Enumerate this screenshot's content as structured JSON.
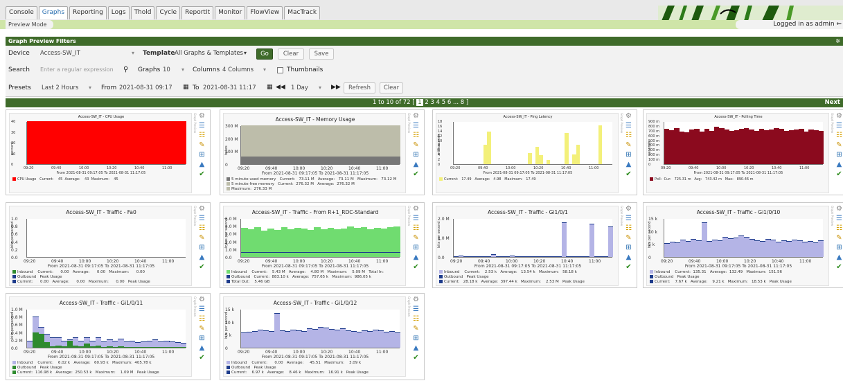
{
  "nav": {
    "tabs": [
      "Console",
      "Graphs",
      "Reporting",
      "Logs",
      "Thold",
      "Cycle",
      "ReportIt",
      "Monitor",
      "FlowView",
      "MacTrack"
    ],
    "active_tab": "Graphs",
    "breadcrumb": "Preview Mode",
    "login": "Logged in as admin"
  },
  "filters": {
    "header": "Graph Preview Filters",
    "device_label": "Device",
    "device_value": "Access-SW_IT",
    "template_label": "Template",
    "template_value": "All Graphs & Templates",
    "go": "Go",
    "clear": "Clear",
    "save": "Save",
    "search_label": "Search",
    "search_placeholder": "Enter a regular expression",
    "graphs_label": "Graphs",
    "graphs_value": "10",
    "columns_label": "Columns",
    "columns_value": "4 Columns",
    "thumbnails_label": "Thumbnails",
    "presets_label": "Presets",
    "presets_value": "Last 2 Hours",
    "from_label": "From",
    "from_value": "2021-08-31 09:17",
    "to_label": "To",
    "to_value": "2021-08-31 11:17",
    "span_value": "1 Day",
    "refresh": "Refresh",
    "clear2": "Clear"
  },
  "pagination": {
    "summary": "1 to 10 of 72 [",
    "current": "1",
    "pages": "2 3 4 5 6 ... 8 ]",
    "next": "Next"
  },
  "graphs": [
    {
      "title": "Access-SW_IT - CPU Usage",
      "ylabel": "percent",
      "yticks": [
        "40",
        "30",
        "20",
        "10",
        "0"
      ],
      "xticks": [
        "09:20",
        "09:40",
        "10:00",
        "10:20",
        "10:40",
        "11:00"
      ],
      "from": "From 2021-08-31 09:17:05 To 2021-08-31 11:17:05",
      "legend": [
        "CPU Usage   Current:    45  Average:    43  Maximum:    45"
      ],
      "colors": [
        "#ff0000"
      ],
      "values": [
        100,
        100,
        100,
        100,
        100,
        100,
        100,
        100,
        100,
        100,
        100,
        100,
        100,
        100,
        100,
        100,
        100,
        100,
        100,
        100,
        100,
        100,
        100,
        100
      ]
    },
    {
      "title": "Access-SW_IT - Memory Usage",
      "ylabel": "bytes",
      "yticks": [
        "300 M",
        "200 M",
        "100 M",
        "0"
      ],
      "xticks": [
        "09:20",
        "09:40",
        "10:00",
        "10:20",
        "10:40",
        "11:00"
      ],
      "from": "From 2021-08-31 09:17:05 To 2021-08-31 11:17:05",
      "legend": [
        "5 minute used memory   Current:   73.11 M   Average:   73.11 M   Maximum:   73.12 M",
        "5 minute free memory   Current:  276.32 M   Average:  276.32 M",
        "Maximum:  276.33 M"
      ],
      "colors": [
        "#777777",
        "#bdbdaa"
      ],
      "values": [
        100,
        100,
        100,
        100,
        100,
        100,
        100,
        100,
        100,
        100,
        100,
        100,
        100,
        100,
        100,
        100,
        100,
        100,
        100,
        100,
        100,
        100,
        100,
        100
      ]
    },
    {
      "title": "Access-SW_IT - Ping Latency",
      "ylabel": "milliseconds",
      "yticks": [
        "18",
        "16",
        "14",
        "12",
        "10",
        "8",
        "6",
        "4",
        "2",
        "0"
      ],
      "xticks": [
        "09:20",
        "09:40",
        "10:00",
        "10:20",
        "10:40",
        "11:00"
      ],
      "from": "From 2021-08-31 09:17:05 To 2021-08-31 11:17:05",
      "legend": [
        "Current:   17.49   Average:   4.98   Maximum:   17.49"
      ],
      "colors": [
        "#f3f07a"
      ],
      "values": [
        0,
        0,
        0,
        0,
        0,
        0,
        0,
        0,
        50,
        84,
        0,
        0,
        0,
        0,
        0,
        0,
        0,
        0,
        0,
        0,
        28,
        0,
        44,
        24,
        0,
        10,
        0,
        0,
        0,
        0,
        80,
        0,
        26,
        50,
        0,
        0,
        0,
        0,
        0,
        100,
        0,
        0,
        0
      ]
    },
    {
      "title": "Access-SW_IT - Polling Time",
      "ylabel": "seconds",
      "yticks": [
        "900 m",
        "800 m",
        "700 m",
        "600 m",
        "500 m",
        "400 m",
        "300 m",
        "200 m",
        "100 m",
        "0"
      ],
      "xticks": [
        "09:20",
        "09:40",
        "10:00",
        "10:20",
        "10:40",
        "11:00"
      ],
      "from": "From 2021-08-31 09:17:05 To 2021-08-31 11:17:05",
      "legend": [
        "Poll:  Cur:   725.31 m   Avg:   743.42 m   Max:   890.46 m"
      ],
      "colors": [
        "#8b0a1e"
      ],
      "values": [
        92,
        88,
        94,
        84,
        82,
        90,
        92,
        84,
        92,
        86,
        96,
        94,
        90,
        86,
        88,
        92,
        94,
        90,
        86,
        92,
        88,
        90,
        94,
        92,
        86,
        88,
        90,
        92,
        84,
        90,
        88,
        86
      ]
    },
    {
      "title": "Access-SW_IT - Traffic - Fa0",
      "ylabel": "bits per second",
      "yticks": [
        "1.0",
        "0.8",
        "0.6",
        "0.4",
        "0.2",
        "0.0"
      ],
      "xticks": [
        "09:20",
        "09:40",
        "10:00",
        "10:20",
        "10:40",
        "11:00"
      ],
      "from": "From 2021-08-31 09:17:05 To 2021-08-31 11:17:05",
      "legend": [
        "Inbound    Current:      0.00   Average:      0.00   Maximum:      0.00",
        "Outbound   Peak Usage",
        "Current:      0.00   Average:      0.00   Maximum:      0.00   Peak Usage"
      ],
      "colors": [
        "#2e8b2e",
        "#1e3c8c"
      ],
      "values": []
    },
    {
      "title": "Access-SW_IT - Traffic - From R+1_RDC-Standard",
      "ylabel": "bytes per second",
      "yticks": [
        "5.0 M",
        "4.0 M",
        "3.0 M",
        "2.0 M",
        "1.0 M",
        "0.0"
      ],
      "xticks": [
        "09:20",
        "09:40",
        "10:00",
        "10:20",
        "10:40",
        "11:00"
      ],
      "from": "From 2021-08-31 09:17:05 To 2021-08-31 11:17:05",
      "legend": [
        "Inbound    Current:    5.43 M   Average:    4.80 M   Maximum:    5.09 M   Total In:",
        "Outbound   Current:  883.10 k   Average:  757.65 k   Maximum:  986.05 k",
        "Total Out:    5.46 GB"
      ],
      "colors": [
        "#70dc70",
        "#1e3c8c"
      ],
      "values": [
        84,
        80,
        86,
        76,
        82,
        78,
        86,
        80,
        84,
        82,
        78,
        86,
        80,
        84,
        80,
        82,
        88,
        84,
        86,
        80,
        84,
        82,
        86,
        88
      ]
    },
    {
      "title": "Access-SW_IT - Traffic - Gi1/0/1",
      "ylabel": "bits per second",
      "yticks": [
        "2.0 M",
        "1.0 M",
        "0.0"
      ],
      "xticks": [
        "09:20",
        "09:40",
        "10:00",
        "10:20",
        "10:40",
        "11:00"
      ],
      "from": "From 2021-08-31 09:17:05 To 2021-08-31 11:17:05",
      "legend": [
        "Inbound    Current:    2.53 k   Average:   13.54 k   Maximum:   58.18 k",
        "Outbound   Peak Usage",
        "Current:   28.18 k   Average:  397.44 k   Maximum:    2.53 M   Peak Usage"
      ],
      "colors": [
        "#b4b4e6",
        "#1e3c8c"
      ],
      "values": [
        0,
        4,
        0,
        0,
        0,
        0,
        0,
        0,
        8,
        0,
        0,
        0,
        4,
        0,
        0,
        0,
        0,
        0,
        0,
        0,
        0,
        2,
        0,
        100,
        0,
        0,
        0,
        0,
        0,
        96,
        0,
        0,
        0,
        88
      ]
    },
    {
      "title": "Access-SW_IT - Traffic - Gi1/0/10",
      "ylabel": "bits per second",
      "yticks": [
        "15 k",
        "10 k",
        "5 k",
        "0"
      ],
      "xticks": [
        "09:20",
        "09:40",
        "10:00",
        "10:20",
        "10:40",
        "11:00"
      ],
      "from": "From 2021-08-31 09:17:05 To 2021-08-31 11:17:05",
      "legend": [
        "Inbound    Current:  135.31   Average:  132.49   Maximum:  151.56",
        "Outbound   Peak Usage",
        "Current:    7.67 k   Average:    9.21 k   Maximum:   18.53 k   Peak Usage"
      ],
      "colors": [
        "#b4b4e6",
        "#1e3c8c"
      ],
      "values": [
        40,
        44,
        42,
        50,
        46,
        52,
        48,
        100,
        46,
        50,
        48,
        58,
        54,
        56,
        62,
        58,
        52,
        48,
        46,
        52,
        50,
        44,
        48,
        46,
        50,
        48,
        44,
        46,
        42,
        48
      ]
    },
    {
      "title": "Access-SW_IT - Traffic - Gi1/0/11",
      "ylabel": "bits per second",
      "yticks": [
        "1.0 M",
        "0.8 M",
        "0.6 M",
        "0.4 M",
        "0.2 M",
        "0.0"
      ],
      "xticks": [
        "09:20",
        "09:40",
        "10:00",
        "10:20",
        "10:40",
        "11:00"
      ],
      "from": "From 2021-08-31 09:17:05 To 2021-08-31 11:17:05",
      "legend": [
        "Inbound    Current:    6.02 k   Average:   60.93 k   Maximum:  405.78 k",
        "Outbound   Peak Usage",
        "Current:  116.98 k   Average:  250.53 k   Maximum:    1.09 M   Peak Usage"
      ],
      "colors": [
        "#b4b4e6",
        "#2e8b2e"
      ],
      "values": [
        20,
        90,
        60,
        40,
        30,
        30,
        20,
        24,
        30,
        20,
        30,
        20,
        30,
        18,
        24,
        20,
        26,
        18,
        20,
        16,
        18,
        20,
        24,
        18,
        20,
        18,
        16,
        14
      ],
      "inbound": [
        0,
        44,
        40,
        16,
        4,
        6,
        4,
        20,
        6,
        4,
        12,
        4,
        6,
        2,
        4,
        2,
        4,
        2,
        2,
        2,
        2,
        2,
        2,
        2,
        2,
        2,
        2,
        2
      ]
    },
    {
      "title": "Access-SW_IT - Traffic - Gi1/0/12",
      "ylabel": "bits per second",
      "yticks": [
        "15 k",
        "10 k",
        "5 k",
        "0"
      ],
      "xticks": [
        "09:20",
        "09:40",
        "10:00",
        "10:20",
        "10:40",
        "11:00"
      ],
      "from": "From 2021-08-31 09:17:05 To 2021-08-31 11:17:05",
      "legend": [
        "Inbound    Current:      0.00   Average:     45.51   Maximum:    3.09 k",
        "Outbound   Peak Usage",
        "Current:    6.97 k   Average:    8.46 k   Maximum:   16.91 k   Peak Usage"
      ],
      "colors": [
        "#b4b4e6",
        "#1e3c8c"
      ],
      "values": [
        44,
        46,
        48,
        52,
        50,
        48,
        100,
        50,
        48,
        52,
        50,
        48,
        56,
        54,
        60,
        58,
        54,
        52,
        56,
        50,
        48,
        46,
        50,
        48,
        52,
        50,
        46,
        48,
        44
      ]
    }
  ],
  "sidebar_text": "Graph Preview"
}
